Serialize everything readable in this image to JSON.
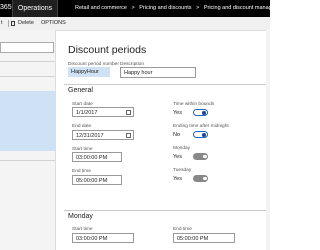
{
  "topbar": {
    "app_suffix": "365",
    "module": "Operations",
    "breadcrumbs": [
      "Retail and commerce",
      ">",
      "Pricing and discounts",
      ">",
      "Pricing and discount managem"
    ]
  },
  "toolbar": {
    "prev_item": "t",
    "delete_label": "Delete",
    "options_label": "OPTIONS"
  },
  "page": {
    "title": "Discount periods",
    "period_number_label": "Discount period number",
    "period_number_value": "HappyHour",
    "description_label": "Description",
    "description_value": "Happy hour"
  },
  "general": {
    "title": "General",
    "start_date_label": "Start date",
    "start_date_value": "1/1/2017",
    "end_date_label": "End date",
    "end_date_value": "12/31/2017",
    "start_time_label": "Start time",
    "start_time_value": "03:00:00 PM",
    "end_time_label": "End time",
    "end_time_value": "05:00:00 PM",
    "time_within_bounds_label": "Time within bounds",
    "time_within_bounds_value": "Yes",
    "ending_time_label": "Ending time after midnight",
    "ending_time_value": "No",
    "monday_label": "Monday",
    "monday_value": "Yes",
    "tuesday_label": "Tuesday",
    "tuesday_value": "Yes"
  },
  "monday_section": {
    "title": "Monday",
    "start_time_label": "Start time",
    "start_time_value": "03:00:00 PM",
    "end_time_label": "End time",
    "end_time_value": "05:00:00 PM"
  },
  "colors": {
    "topbar": "#000000",
    "selected_row": "#cfe2f5",
    "toggle_on": "#1a4d99",
    "toggle_off": "#888888"
  }
}
